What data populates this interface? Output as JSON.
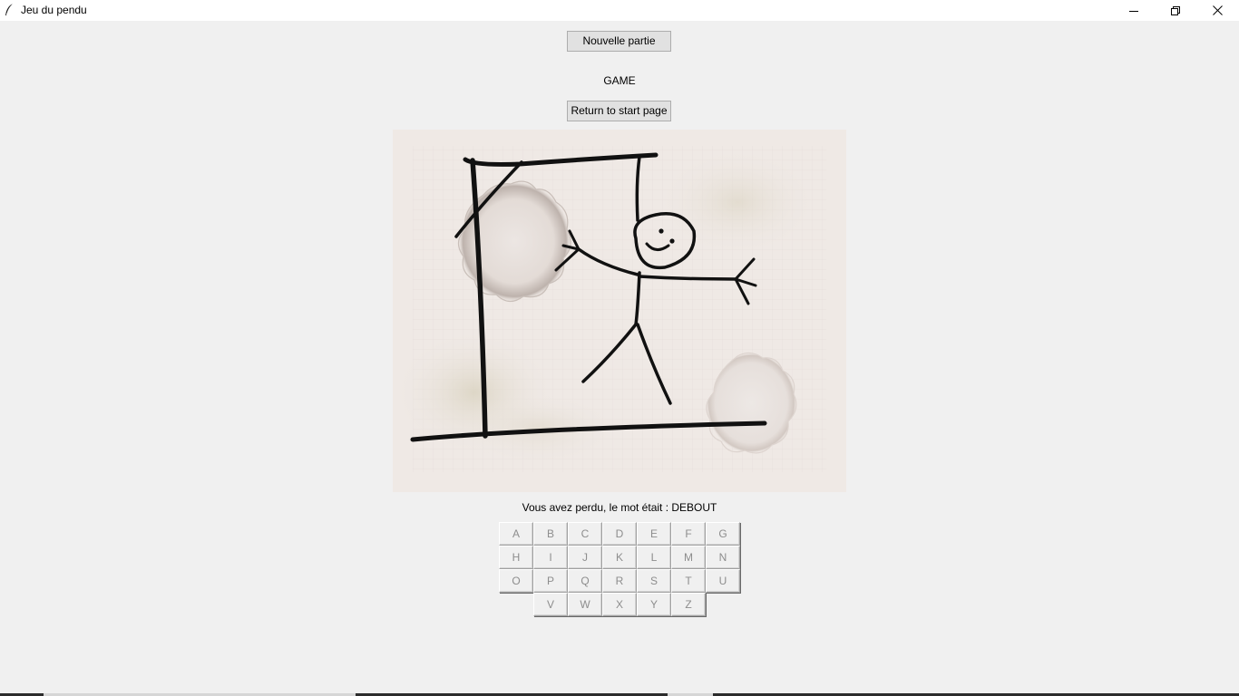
{
  "window": {
    "title": "Jeu du pendu",
    "controls": [
      "minimize-icon",
      "restore-icon",
      "close-icon"
    ]
  },
  "buttons": {
    "new_game": "Nouvelle partie",
    "return_start": "Return to start page"
  },
  "labels": {
    "game": "GAME",
    "result": "Vous avez perdu, le mot était : DEBOUT"
  },
  "keyboard": {
    "rows": [
      [
        "A",
        "B",
        "C",
        "D",
        "E",
        "F",
        "G"
      ],
      [
        "H",
        "I",
        "J",
        "K",
        "L",
        "M",
        "N"
      ],
      [
        "O",
        "P",
        "Q",
        "R",
        "S",
        "T",
        "U"
      ],
      [
        "V",
        "W",
        "X",
        "Y",
        "Z"
      ]
    ],
    "state": "disabled"
  },
  "colors": {
    "background": "#f0f0f0",
    "disabled_text": "#8d8d8d",
    "drawing_ink": "#111111",
    "paper": "#efe9e5"
  }
}
